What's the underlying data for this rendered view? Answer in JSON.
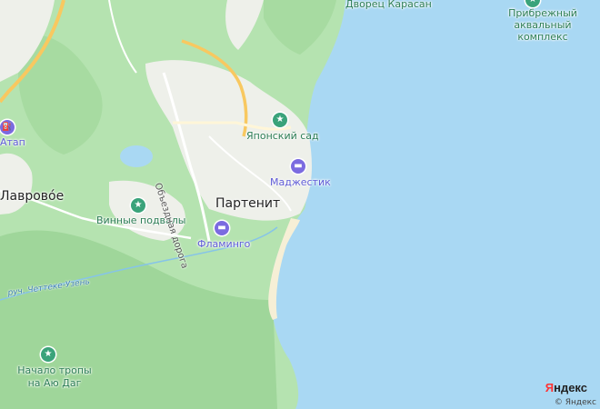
{
  "map": {
    "colors": {
      "sea": "#a9d8f3",
      "forest": "#b5e3b0",
      "forest_dark": "#9fd69a",
      "urban": "#eef0ea",
      "road_main": "#f8c860",
      "beach": "#f6efd6"
    },
    "pois": [
      {
        "label": "Дворец Карасан",
        "kind": "landmark",
        "icon": "star-icon"
      },
      {
        "label": "Прибрежный аквальный комплекс",
        "kind": "landmark",
        "icon": "star-icon"
      },
      {
        "label": "Японский сад",
        "kind": "landmark",
        "icon": "star-icon"
      },
      {
        "label": "Маджестик",
        "kind": "hotel",
        "icon": "bed-icon"
      },
      {
        "label": "Фламинго",
        "kind": "hotel",
        "icon": "bed-icon"
      },
      {
        "label": "Винные подвалы",
        "kind": "landmark",
        "icon": "star-icon"
      },
      {
        "label": "Начало тропы на Аю Даг",
        "kind": "landmark",
        "icon": "star-icon"
      },
      {
        "label": "Атап",
        "kind": "fuel",
        "icon": "fuel-icon"
      }
    ],
    "places": [
      {
        "label": "Партенит"
      },
      {
        "label": "Лаврово́е"
      }
    ],
    "roads": [
      {
        "label": "Объездная дорога"
      }
    ],
    "waterways": [
      {
        "label": "руч. Четтеке-Узень"
      }
    ]
  },
  "branding": {
    "logo": "Яндекс",
    "copyright": "© Яндекс"
  }
}
